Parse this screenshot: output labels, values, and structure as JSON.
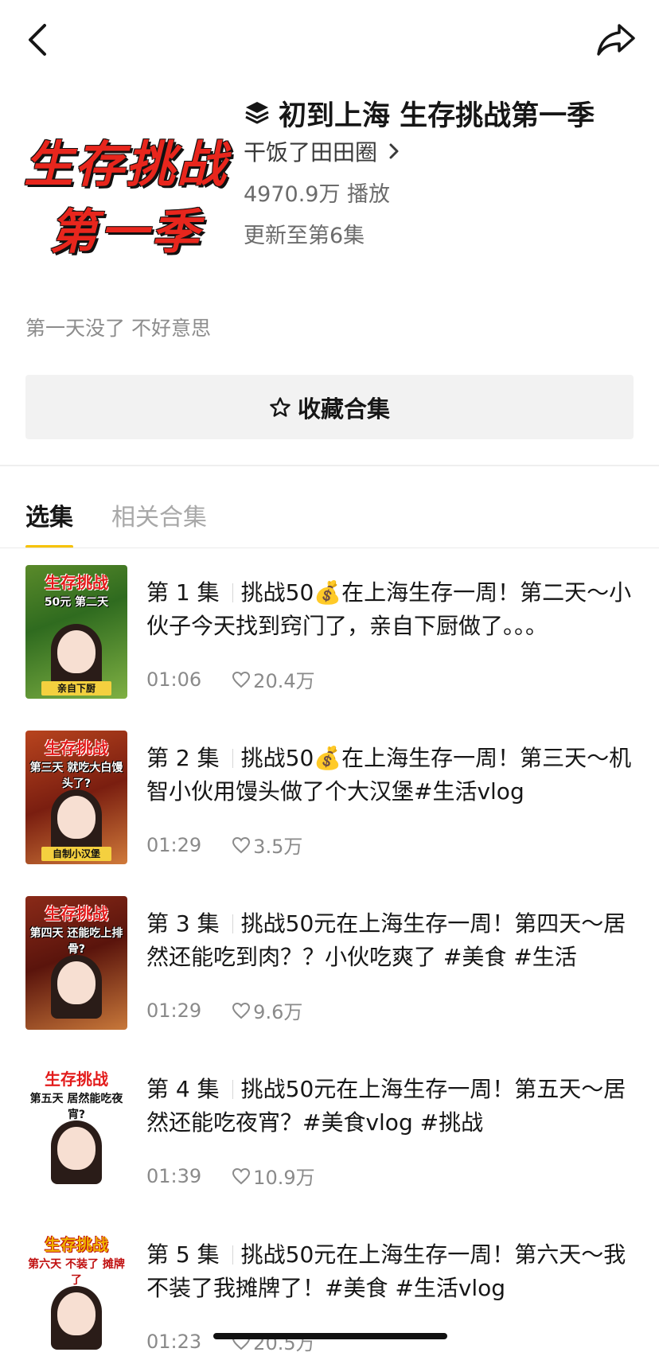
{
  "nav": {
    "back_icon": "chevron-left-icon",
    "share_icon": "share-arrow-icon"
  },
  "collection": {
    "cover_line1": "生存挑战",
    "cover_line2": "第一季",
    "title_icon": "layers-icon",
    "title": "初到上海  生存挑战第一季",
    "author": "干饭了田田圈",
    "plays": "4970.9万 播放",
    "update": "更新至第6集",
    "description": "第一天没了 不好意思"
  },
  "collect_button": {
    "icon": "star-outline-icon",
    "label": "收藏合集"
  },
  "tabs": [
    {
      "label": "选集",
      "active": true
    },
    {
      "label": "相关合集",
      "active": false
    }
  ],
  "accent_color": "#f6c200",
  "episodes": [
    {
      "number": "第 1 集",
      "title": "挑战50💰在上海生存一周！第二天～小伙子今天找到窍门了，亲自下厨做了。。。",
      "duration": "01:06",
      "likes": "20.4万",
      "thumb_title": "生存挑战",
      "thumb_sub": "50元 第二天",
      "thumb_tag": "亲自下厨"
    },
    {
      "number": "第 2 集",
      "title": "挑战50💰在上海生存一周！第三天～机智小伙用馒头做了个大汉堡#生活vlog",
      "duration": "01:29",
      "likes": "3.5万",
      "thumb_title": "生存挑战",
      "thumb_sub": "第三天 就吃大白馒头了?",
      "thumb_tag": "自制小汉堡"
    },
    {
      "number": "第 3 集",
      "title": "挑战50元在上海生存一周！第四天～居然还能吃到肉？？小伙吃爽了 #美食  #生活",
      "duration": "01:29",
      "likes": "9.6万",
      "thumb_title": "生存挑战",
      "thumb_sub": "第四天 还能吃上排骨?",
      "thumb_tag": ""
    },
    {
      "number": "第 4 集",
      "title": "挑战50元在上海生存一周！第五天～居然还能吃夜宵？#美食vlog #挑战",
      "duration": "01:39",
      "likes": "10.9万",
      "thumb_title": "生存挑战",
      "thumb_sub": "第五天 居然能吃夜宵?",
      "thumb_tag": ""
    },
    {
      "number": "第 5 集",
      "title": "挑战50元在上海生存一周！第六天～我不装了我摊牌了！#美食 #生活vlog",
      "duration": "01:23",
      "likes": "20.5万",
      "thumb_title": "生存挑战",
      "thumb_sub": "第六天 不装了 摊牌了",
      "thumb_tag": ""
    }
  ]
}
